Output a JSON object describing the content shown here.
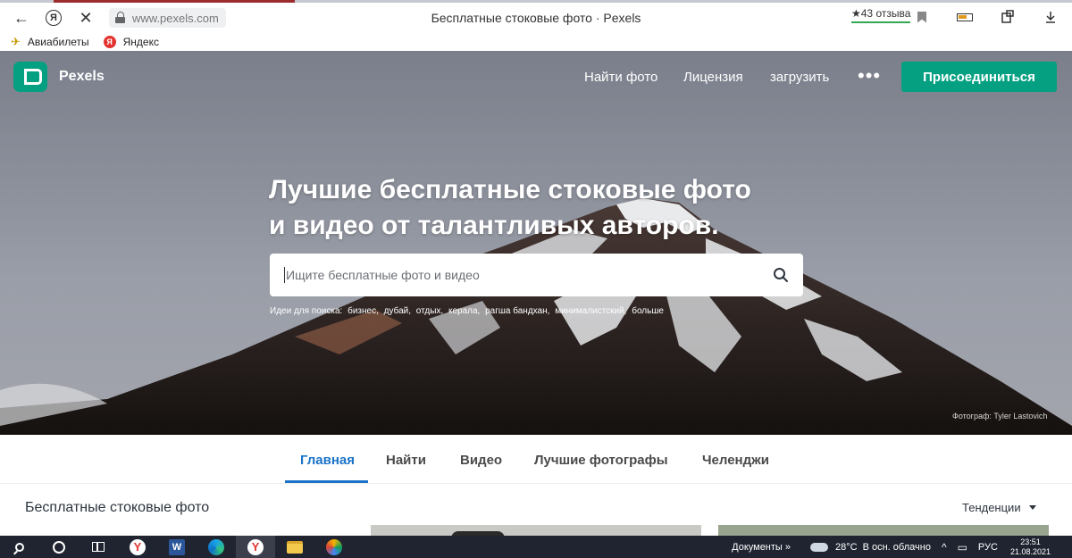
{
  "browser": {
    "nav_back_glyph": "←",
    "yandex_glyph": "Я",
    "stop_glyph": "✕",
    "url": "www.pexels.com",
    "tab_title": "Бесплатные стоковые фото · Pexels",
    "reviews": "★43 отзыва",
    "bookmarks": [
      {
        "label": "Авиабилеты",
        "icon": "airplane-icon"
      },
      {
        "label": "Яндекс",
        "icon": "yandex-icon"
      }
    ]
  },
  "header": {
    "logo_text": "Pexels",
    "nav": [
      "Найти фото",
      "Лицензия",
      "загрузить"
    ],
    "more_glyph": "•••",
    "join_label": "Присоединиться"
  },
  "hero": {
    "headline_line1": "Лучшие бесплатные стоковые фото",
    "headline_line2": "и видео от талантливых авторов.",
    "search_placeholder": "Ищите бесплатные фото и видео",
    "ideas_label": "Идеи для поиска:",
    "ideas": [
      "бизнес,",
      "дубай,",
      "отдых,",
      "керала,",
      "рагша бандхан,",
      "минималистский,",
      "больше"
    ],
    "photo_credit": "Фотограф: Tyler Lastovich"
  },
  "tabs": [
    "Главная",
    "Найти",
    "Видео",
    "Лучшие фотографы",
    "Челенджи"
  ],
  "content": {
    "title": "Бесплатные стоковые фото",
    "sort_label": "Тенденции"
  },
  "taskbar": {
    "documents": "Документы",
    "chevron": "»",
    "temperature": "28°C",
    "weather": "В осн. облачно",
    "tray_arrow": "^",
    "language": "РУС",
    "time": "23:51",
    "date": "21.08.2021"
  },
  "colors": {
    "brand_green": "#05a081",
    "active_tab_blue": "#1a73c9",
    "taskbar_bg": "#1f2430"
  }
}
